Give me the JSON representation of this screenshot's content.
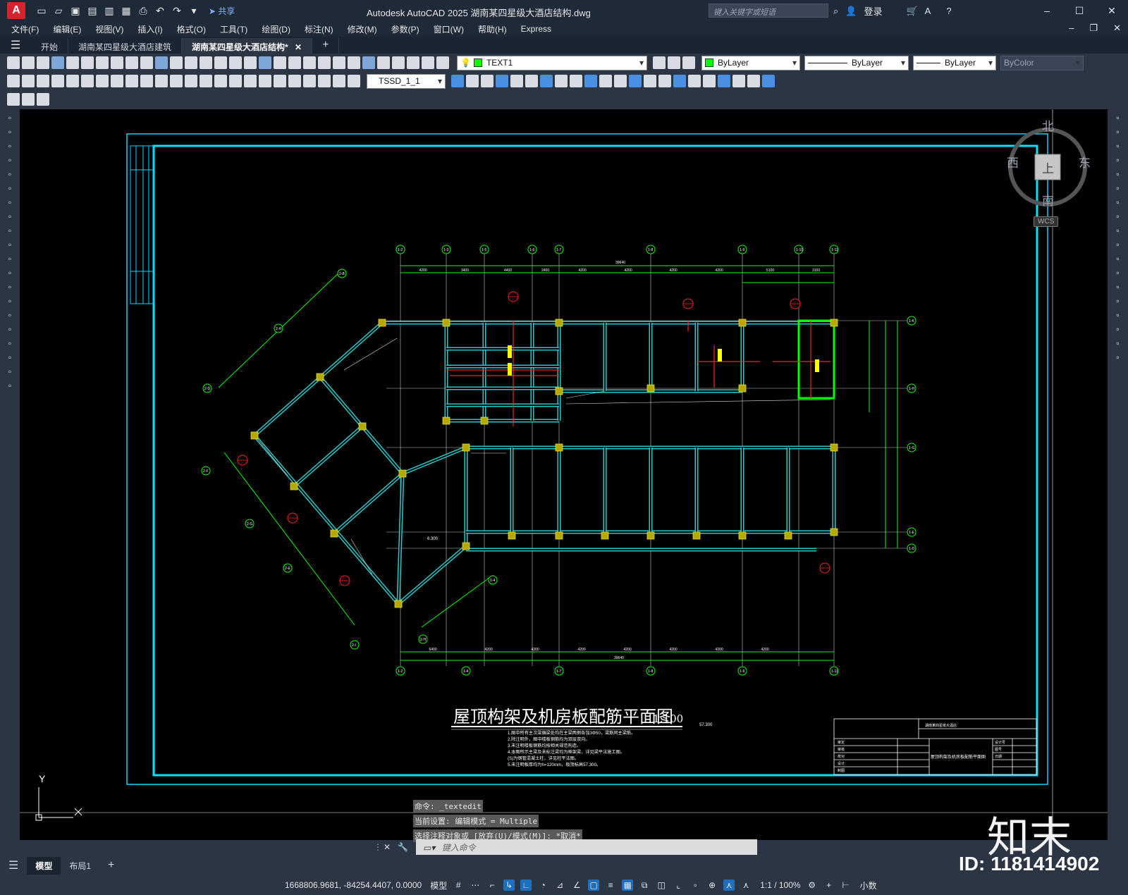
{
  "app": {
    "logo_letter": "A",
    "window_title": "Autodesk AutoCAD 2025    湖南某四星级大酒店结构.dwg",
    "share_label": "共享",
    "search_placeholder": "键入关键字或短语",
    "login_label": "登录"
  },
  "menu": [
    "文件(F)",
    "编辑(E)",
    "视图(V)",
    "插入(I)",
    "格式(O)",
    "工具(T)",
    "绘图(D)",
    "标注(N)",
    "修改(M)",
    "参数(P)",
    "窗口(W)",
    "帮助(H)",
    "Express"
  ],
  "doc_tabs": [
    "开始",
    "湖南某四星级大酒店建筑",
    "湖南某四星级大酒店结构*"
  ],
  "layer": {
    "name": "TEXT1",
    "color": "#00ff00",
    "color_prop": "ByLayer",
    "linetype": "ByLayer",
    "lineweight": "ByLayer",
    "plotstyle": "ByColor"
  },
  "text_style": "TSSD_1_1",
  "viewcube": {
    "north": "北",
    "south": "南",
    "east": "东",
    "west": "西",
    "face": "上",
    "wcs": "WCS"
  },
  "ucs": {
    "y": "Y"
  },
  "drawing": {
    "title": "屋顶构架及机房板配筋平面图",
    "scale": "1:100",
    "notes": [
      "1.图中所有主次梁偏梁处均在主梁两侧各加3Φ50，梁筋同主梁筋。",
      "2.除注明外，图中楼板钢筋均为双层双向。",
      "3.未注明楼板钢筋均按相关规范构造。",
      "4.本图所示主梁及未标注梁均为框架梁，详见梁平法施工图。",
      "   (S)为钢管混凝土柱，详见柱平法图。",
      "5.未注明板厚均为h=120mm，板顶标高57.300。"
    ],
    "axis_labels_top": [
      "1-2",
      "1-3",
      "1-5",
      "1-6",
      "1-7",
      "1-8",
      "1-9",
      "1-10",
      "1-11"
    ],
    "axis_labels_bottom": [
      "1-2",
      "1-4",
      "1-7",
      "1-8",
      "1-9",
      "1-11"
    ],
    "axis_labels_right": [
      "1-K",
      "1-H",
      "1-G",
      "1-E",
      "1-D"
    ],
    "axis_labels_left": [
      "2-B",
      "2-H",
      "2-D",
      "2-F",
      "2-G",
      "2-E",
      "2-I",
      "2-H"
    ],
    "top_dims": [
      "4200",
      "3400",
      "4400",
      "2400",
      "4200",
      "4200",
      "4200",
      "4200",
      "5100",
      "3100"
    ],
    "top_total": "39640",
    "bottom_dims": [
      "6400",
      "4200",
      "4200",
      "4200",
      "4200",
      "4200",
      "4200",
      "4200"
    ],
    "bottom_total": "39640",
    "elev_label": "6.300",
    "elev_mark": "57.300",
    "title_block": {
      "project": "湖南某四星级大酒店",
      "drawing_name": "屋顶构架及机房板配筋平面图",
      "rows": [
        "审定",
        "审核",
        "校对",
        "设计",
        "制图"
      ],
      "right_rows": [
        "设计号",
        "图号",
        "日期"
      ]
    }
  },
  "command": {
    "history": [
      "命令: _textedit",
      "当前设置: 编辑模式 = Multiple",
      "选择注释对象或 [放弃(U)/模式(M)]: *取消*"
    ],
    "placeholder": "键入命令"
  },
  "layout_tabs": [
    "模型",
    "布局1"
  ],
  "status": {
    "coords": "1668806.9681, -84254.4407, 0.0000",
    "model_label": "模型",
    "scale": "1:1 / 100%",
    "units": "小数"
  },
  "watermark": {
    "logo": "知末",
    "id_text": "ID: 1181414902"
  }
}
